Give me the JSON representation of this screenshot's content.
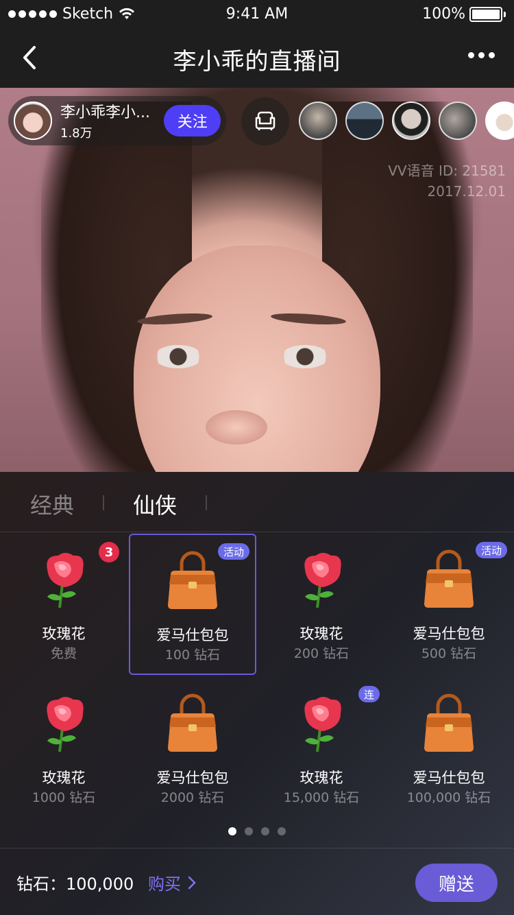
{
  "status_bar": {
    "carrier": "Sketch",
    "time": "9:41 AM",
    "battery": "100%"
  },
  "nav": {
    "title": "李小乖的直播间",
    "back_icon": "chevron-left-icon",
    "more_icon": "more-icon"
  },
  "live": {
    "host": {
      "name": "李小乖李小...",
      "fans": "1.8万",
      "follow_label": "关注"
    },
    "watermark": {
      "id": "VV语音 ID: 21581",
      "date": "2017.12.01"
    },
    "sofa_icon": "sofa-icon",
    "viewers_count": 5
  },
  "gift_panel": {
    "tabs": [
      {
        "label": "经典",
        "active": false
      },
      {
        "label": "仙侠",
        "active": true
      }
    ],
    "gifts": [
      {
        "name": "玫瑰花",
        "price": "免费",
        "icon": "rose-icon",
        "badge_num": "3"
      },
      {
        "name": "爱马仕包包",
        "price": "100 钻石",
        "icon": "handbag-icon",
        "badge_tag": "活动",
        "selected": true
      },
      {
        "name": "玫瑰花",
        "price": "200 钻石",
        "icon": "rose-icon"
      },
      {
        "name": "爱马仕包包",
        "price": "500 钻石",
        "icon": "handbag-icon",
        "badge_tag": "活动"
      },
      {
        "name": "玫瑰花",
        "price": "1000 钻石",
        "icon": "rose-icon"
      },
      {
        "name": "爱马仕包包",
        "price": "2000 钻石",
        "icon": "handbag-icon"
      },
      {
        "name": "玫瑰花",
        "price": "15,000 钻石",
        "icon": "rose-icon",
        "badge_tag": "连"
      },
      {
        "name": "爱马仕包包",
        "price": "100,000  钻石",
        "icon": "handbag-icon"
      }
    ],
    "pager": {
      "pages": 4,
      "current": 1
    },
    "footer": {
      "balance": "钻石：100,000",
      "buy_label": "购买",
      "send_label": "赠送"
    },
    "colors": {
      "accent": "#6a5bd6",
      "badge_red": "#e32d4b",
      "tag_blue": "#6b6bea"
    }
  }
}
